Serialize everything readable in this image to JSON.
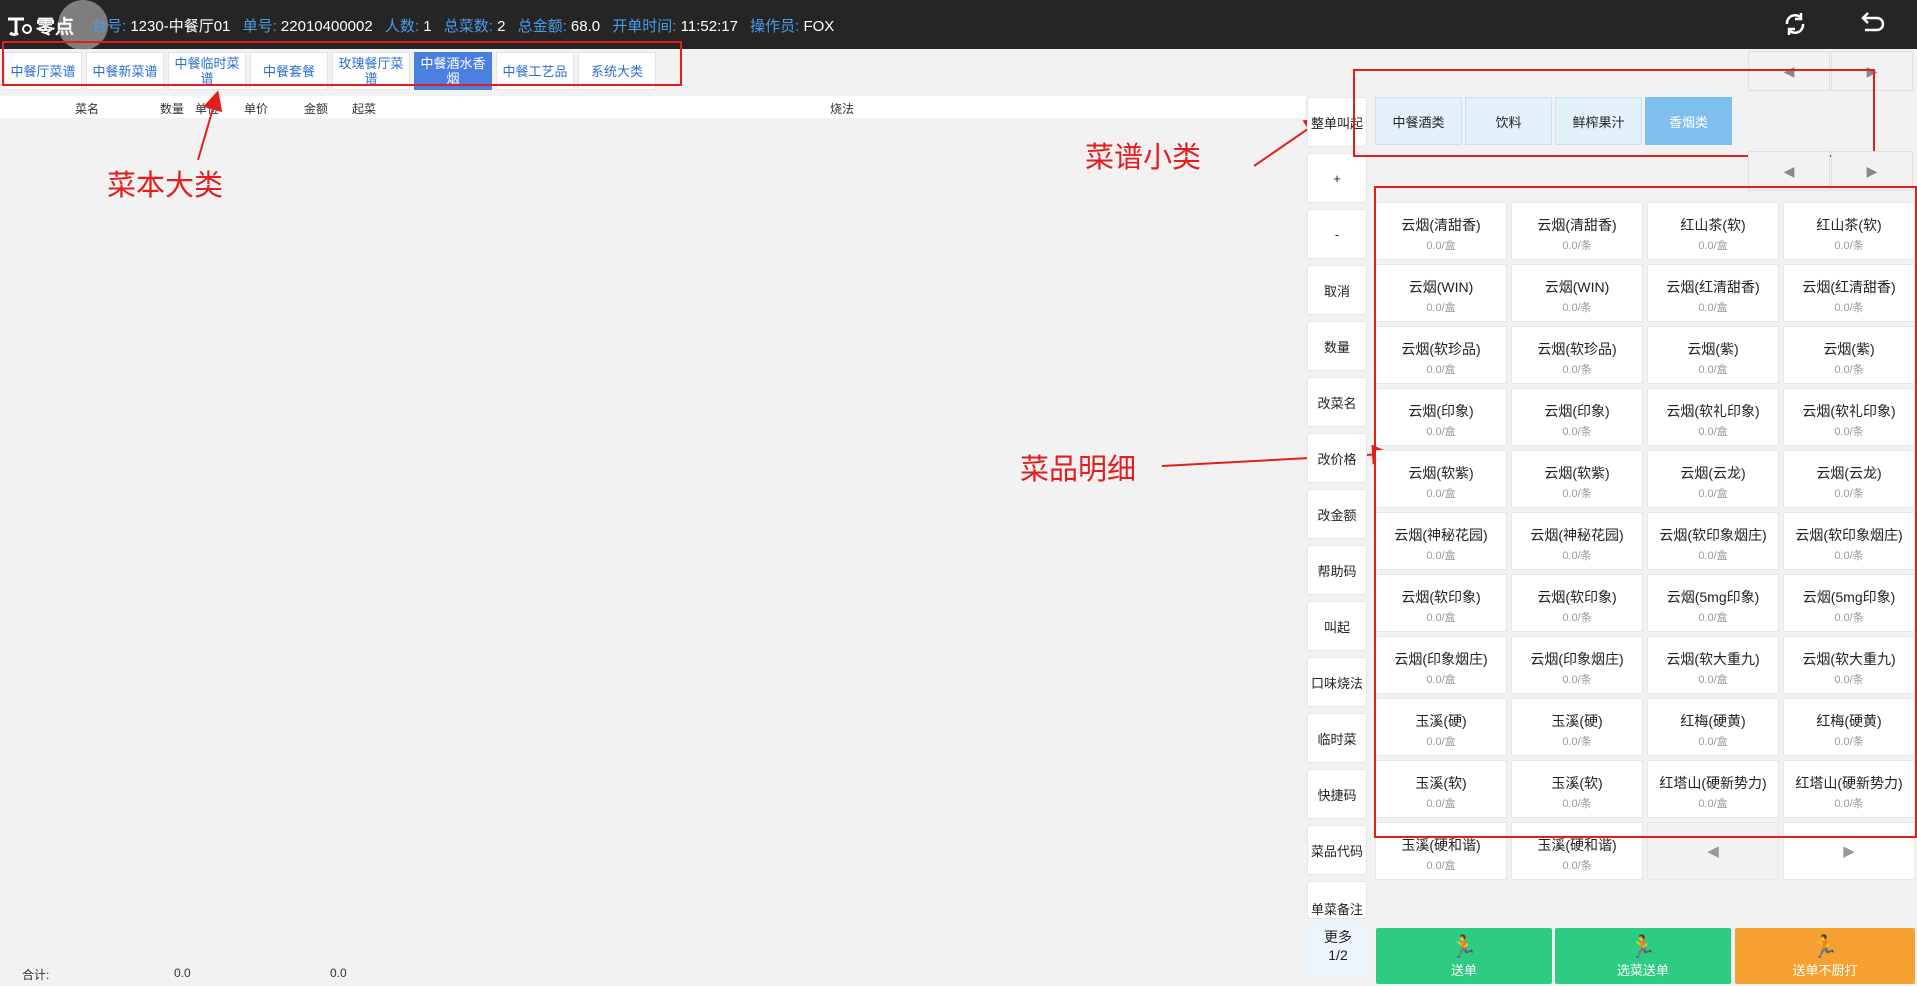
{
  "topbar": {
    "logo_text": "零点",
    "info": [
      {
        "key": "台号:",
        "value": "1230-中餐厅01"
      },
      {
        "key": "单号:",
        "value": "22010400002"
      },
      {
        "key": "人数:",
        "value": "1"
      },
      {
        "key": "总菜数:",
        "value": "2"
      },
      {
        "key": "总金额:",
        "value": "68.0"
      },
      {
        "key": "开单时间:",
        "value": "11:52:17"
      },
      {
        "key": "操作员:",
        "value": "FOX"
      }
    ],
    "refresh_icon": "refresh-icon",
    "back_icon": "return-icon"
  },
  "category_tabs": [
    {
      "label": "中餐厅菜谱",
      "active": false
    },
    {
      "label": "中餐新菜谱",
      "active": false
    },
    {
      "label": "中餐临时菜谱",
      "active": false
    },
    {
      "label": "中餐套餐",
      "active": false
    },
    {
      "label": "玫瑰餐厅菜谱",
      "active": false
    },
    {
      "label": "中餐酒水香烟",
      "active": true
    },
    {
      "label": "中餐工艺品",
      "active": false
    },
    {
      "label": "系统大类",
      "active": false
    }
  ],
  "order_columns": [
    "菜名",
    "数量",
    "单位",
    "单价",
    "金额",
    "起菜",
    "烧法"
  ],
  "annotations": {
    "main_category": "菜本大类",
    "sub_category": "菜谱小类",
    "dish_detail": "菜品明细"
  },
  "function_buttons": [
    "整单叫起",
    "+",
    "-",
    "取消",
    "数量",
    "改菜名",
    "改价格",
    "改金额",
    "帮助码",
    "叫起",
    "口味烧法",
    "临时菜",
    "快捷码",
    "菜品代码",
    "单菜备注"
  ],
  "more_button": {
    "label": "更多",
    "page": "1/2"
  },
  "sub_tabs": [
    {
      "label": "中餐酒类",
      "active": false
    },
    {
      "label": "饮料",
      "active": false
    },
    {
      "label": "鲜榨果汁",
      "active": false
    },
    {
      "label": "香烟类",
      "active": true
    }
  ],
  "pager": {
    "prev": "◀",
    "next": "▶"
  },
  "dishes": [
    {
      "name": "云烟(清甜香)",
      "price": "0.0/盒"
    },
    {
      "name": "云烟(清甜香)",
      "price": "0.0/条"
    },
    {
      "name": "红山茶(软)",
      "price": "0.0/盒"
    },
    {
      "name": "红山茶(软)",
      "price": "0.0/条"
    },
    {
      "name": "云烟(WIN)",
      "price": "0.0/盒"
    },
    {
      "name": "云烟(WIN)",
      "price": "0.0/条"
    },
    {
      "name": "云烟(红清甜香)",
      "price": "0.0/盒"
    },
    {
      "name": "云烟(红清甜香)",
      "price": "0.0/条"
    },
    {
      "name": "云烟(软珍品)",
      "price": "0.0/盒"
    },
    {
      "name": "云烟(软珍品)",
      "price": "0.0/条"
    },
    {
      "name": "云烟(紫)",
      "price": "0.0/盒"
    },
    {
      "name": "云烟(紫)",
      "price": "0.0/条"
    },
    {
      "name": "云烟(印象)",
      "price": "0.0/盒"
    },
    {
      "name": "云烟(印象)",
      "price": "0.0/条"
    },
    {
      "name": "云烟(软礼印象)",
      "price": "0.0/盒"
    },
    {
      "name": "云烟(软礼印象)",
      "price": "0.0/条"
    },
    {
      "name": "云烟(软紫)",
      "price": "0.0/盒"
    },
    {
      "name": "云烟(软紫)",
      "price": "0.0/条"
    },
    {
      "name": "云烟(云龙)",
      "price": "0.0/盒"
    },
    {
      "name": "云烟(云龙)",
      "price": "0.0/条"
    },
    {
      "name": "云烟(神秘花园)",
      "price": "0.0/盒"
    },
    {
      "name": "云烟(神秘花园)",
      "price": "0.0/条"
    },
    {
      "name": "云烟(软印象烟庄)",
      "price": "0.0/盒"
    },
    {
      "name": "云烟(软印象烟庄)",
      "price": "0.0/条"
    },
    {
      "name": "云烟(软印象)",
      "price": "0.0/盒"
    },
    {
      "name": "云烟(软印象)",
      "price": "0.0/条"
    },
    {
      "name": "云烟(5mg印象)",
      "price": "0.0/盒"
    },
    {
      "name": "云烟(5mg印象)",
      "price": "0.0/条"
    },
    {
      "name": "云烟(印象烟庄)",
      "price": "0.0/盒"
    },
    {
      "name": "云烟(印象烟庄)",
      "price": "0.0/条"
    },
    {
      "name": "云烟(软大重九)",
      "price": "0.0/盒"
    },
    {
      "name": "云烟(软大重九)",
      "price": "0.0/条"
    },
    {
      "name": "玉溪(硬)",
      "price": "0.0/盒"
    },
    {
      "name": "玉溪(硬)",
      "price": "0.0/条"
    },
    {
      "name": "红梅(硬黄)",
      "price": "0.0/盒"
    },
    {
      "name": "红梅(硬黄)",
      "price": "0.0/条"
    },
    {
      "name": "玉溪(软)",
      "price": "0.0/盒"
    },
    {
      "name": "玉溪(软)",
      "price": "0.0/条"
    },
    {
      "name": "红塔山(硬新势力)",
      "price": "0.0/盒"
    },
    {
      "name": "红塔山(硬新势力)",
      "price": "0.0/条"
    },
    {
      "name": "玉溪(硬和谐)",
      "price": "0.0/盒"
    },
    {
      "name": "玉溪(硬和谐)",
      "price": "0.0/条"
    }
  ],
  "footer": {
    "total_label": "合计:",
    "qty_total": "0.0",
    "amount_total": "0.0"
  },
  "actions": [
    {
      "label": "送单",
      "color": "#2ecc82"
    },
    {
      "label": "选菜送单",
      "color": "#2ecc82"
    },
    {
      "label": "送单不厨打",
      "color": "#f5a030"
    }
  ]
}
